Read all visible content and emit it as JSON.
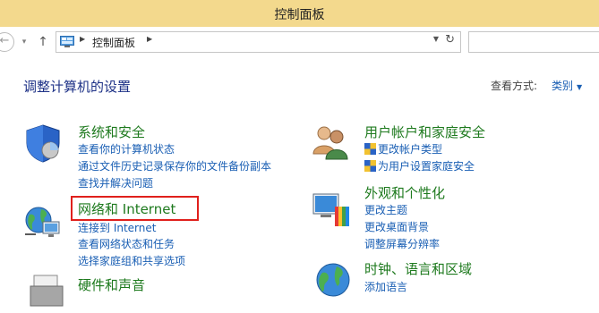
{
  "window": {
    "title": "控制面板"
  },
  "nav": {
    "back_icon": "back-arrow-icon",
    "up_icon": "up-arrow-icon",
    "address": {
      "separator": "▶",
      "crumb": "控制面板",
      "history_icon": "▼",
      "refresh_icon": "↻"
    }
  },
  "main": {
    "heading": "调整计算机的设置",
    "view_by_label": "查看方式:",
    "view_by_value": "类别"
  },
  "categories": {
    "system": {
      "title": "系统和安全",
      "links": [
        "查看你的计算机状态",
        "通过文件历史记录保存你的文件备份副本",
        "查找并解决问题"
      ]
    },
    "network": {
      "title": "网络和 Internet",
      "links": [
        "连接到 Internet",
        "查看网络状态和任务",
        "选择家庭组和共享选项"
      ]
    },
    "hardware": {
      "title": "硬件和声音"
    },
    "users": {
      "title": "用户帐户和家庭安全",
      "links": [
        "更改帐户类型",
        "为用户设置家庭安全"
      ]
    },
    "appearance": {
      "title": "外观和个性化",
      "links": [
        "更改主题",
        "更改桌面背景",
        "调整屏幕分辨率"
      ]
    },
    "clock": {
      "title": "时钟、语言和区域",
      "links": [
        "添加语言"
      ]
    }
  },
  "colors": {
    "titlebar": "#f3d98d",
    "category_title": "#1e7a1e",
    "link": "#1a5fb4",
    "heading": "#1e3287",
    "highlight": "#e0201c"
  }
}
